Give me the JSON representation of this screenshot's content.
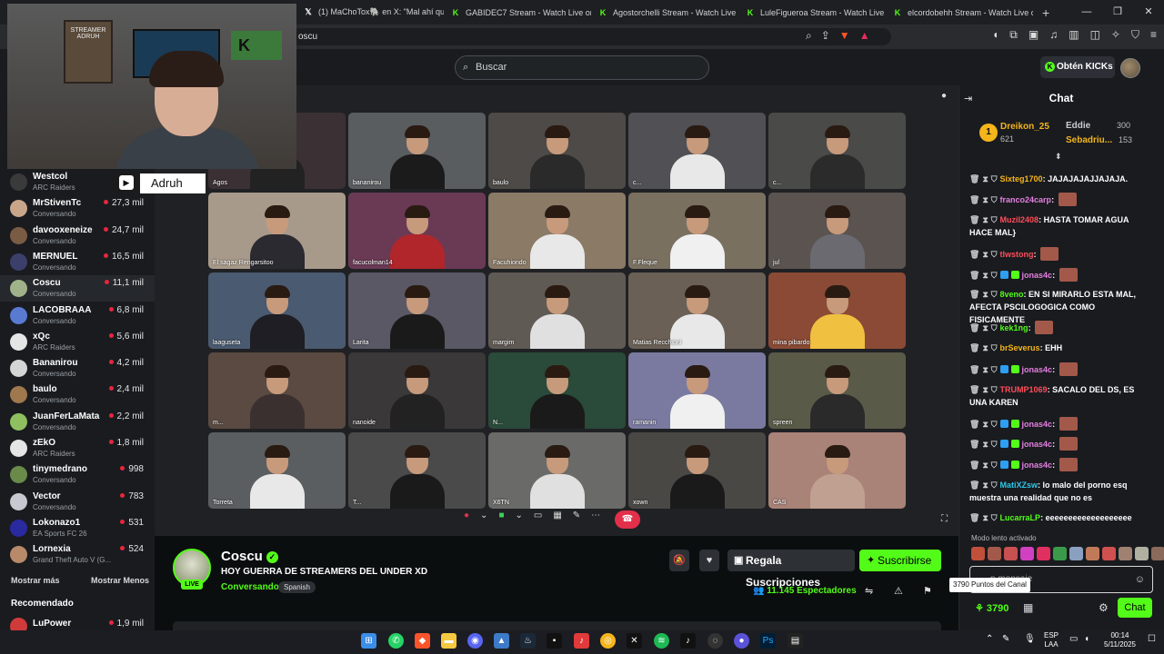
{
  "browser": {
    "tabs": [
      {
        "title": "(1) MaChoTox🐘 en X: \"Mal ahí que",
        "icon": "x"
      },
      {
        "title": "GABIDEC7 Stream - Watch Live on K",
        "icon": "kick"
      },
      {
        "title": "Agostorchelli Stream - Watch Live on",
        "icon": "kick"
      },
      {
        "title": "LuleFigueroa Stream - Watch Live on",
        "icon": "kick"
      },
      {
        "title": "elcordobehh Stream - Watch Live on",
        "icon": "kick"
      }
    ],
    "new_tab": "+",
    "url": "oscu"
  },
  "header": {
    "search_placeholder": "Buscar",
    "kicks_button": "Obtén KICKs"
  },
  "webcam": {
    "poster": "STREAMER ADRUH",
    "sign": "K",
    "name_tag": "Adruh"
  },
  "sidebar": {
    "channels": [
      {
        "name": "Westcol",
        "sub": "ARC Raiders",
        "viewers": "",
        "color": "#3a3a3a"
      },
      {
        "name": "MrStivenTc",
        "sub": "Conversando",
        "viewers": "27,3 mil",
        "color": "#c9a58a"
      },
      {
        "name": "davooxeneize",
        "sub": "Conversando",
        "viewers": "24,7 mil",
        "color": "#7a5b44"
      },
      {
        "name": "MERNUEL",
        "sub": "Conversando",
        "viewers": "16,5 mil",
        "color": "#3b3f6a"
      },
      {
        "name": "Coscu",
        "sub": "Conversando",
        "viewers": "11,1 mil",
        "color": "#9fb28a"
      },
      {
        "name": "LACOBRAAA",
        "sub": "Conversando",
        "viewers": "6,8 mil",
        "color": "#5a7ad2"
      },
      {
        "name": "xQc",
        "sub": "ARC Raiders",
        "viewers": "5,6 mil",
        "color": "#e5e5e5"
      },
      {
        "name": "Bananirou",
        "sub": "Conversando",
        "viewers": "4,2 mil",
        "color": "#d5d5d5"
      },
      {
        "name": "baulo",
        "sub": "Conversando",
        "viewers": "2,4 mil",
        "color": "#a0784e"
      },
      {
        "name": "JuanFerLaMata",
        "sub": "Conversando",
        "viewers": "2,2 mil",
        "color": "#8fc060"
      },
      {
        "name": "zEkO",
        "sub": "ARC Raiders",
        "viewers": "1,8 mil",
        "color": "#e5e5e5"
      },
      {
        "name": "tinymedrano",
        "sub": "Conversando",
        "viewers": "998",
        "color": "#6a8a4a"
      },
      {
        "name": "Vector",
        "sub": "Conversando",
        "viewers": "783",
        "color": "#c8c8d0"
      },
      {
        "name": "Lokonazo1",
        "sub": "EA Sports FC 26",
        "viewers": "531",
        "color": "#2a2aa0"
      },
      {
        "name": "Lornexia",
        "sub": "Grand Theft Auto V (G...",
        "viewers": "524",
        "color": "#b88a6a"
      }
    ],
    "show_more": "Mostrar más",
    "show_less": "Mostrar Menos",
    "recommended_label": "Recomendado",
    "recommended": [
      {
        "name": "LuPower",
        "viewers": "1,9 mil"
      }
    ]
  },
  "call": {
    "tiles": [
      {
        "name": "Agos",
        "bg": "#3b3135",
        "shirt": "#222"
      },
      {
        "name": "bananirou",
        "bg": "#5a5d60",
        "shirt": "#1b1b1b"
      },
      {
        "name": "baulo",
        "bg": "#4d4a47",
        "shirt": "#2a2a2a"
      },
      {
        "name": "c...",
        "bg": "#505055",
        "shirt": "#e8e8e8"
      },
      {
        "name": "c...",
        "bg": "#4a4a48",
        "shirt": "#2b2b2b"
      },
      {
        "name": "El sagaz Rengarsitoo",
        "bg": "#a89a8a",
        "shirt": "#2a2a30"
      },
      {
        "name": "facucolman14",
        "bg": "#6a3a55",
        "shirt": "#b0262b"
      },
      {
        "name": "Facuhiondo",
        "bg": "#8a7a66",
        "shirt": "#e8e8e8"
      },
      {
        "name": "F.Fleque",
        "bg": "#7a7060",
        "shirt": "#f0f0f0"
      },
      {
        "name": "jul",
        "bg": "#5a5350",
        "shirt": "#6a6a70"
      },
      {
        "name": "laaguseta",
        "bg": "#4a5a70",
        "shirt": "#1e1e24"
      },
      {
        "name": "Larita",
        "bg": "#5a5865",
        "shirt": "#1a1a1a"
      },
      {
        "name": "margim",
        "bg": "#605a55",
        "shirt": "#e0e0e0"
      },
      {
        "name": "Matias Recchioni",
        "bg": "#6a6055",
        "shirt": "#e8e8e8"
      },
      {
        "name": "mina pibardo",
        "bg": "#8a4a35",
        "shirt": "#f0c040"
      },
      {
        "name": "m...",
        "bg": "#5a4a42",
        "shirt": "#3a3030"
      },
      {
        "name": "nanoide",
        "bg": "#3a3838",
        "shirt": "#222"
      },
      {
        "name": "N...",
        "bg": "#2a4a3a",
        "shirt": "#1a1a1a"
      },
      {
        "name": "ramanin",
        "bg": "#7a7aa0",
        "shirt": "#f0f0f0"
      },
      {
        "name": "spreen",
        "bg": "#5a5a48",
        "shirt": "#2a2a2a"
      },
      {
        "name": "Torreta",
        "bg": "#5a5e60",
        "shirt": "#e8e8e8"
      },
      {
        "name": "T...",
        "bg": "#4a4a4a",
        "shirt": "#1a1a1a"
      },
      {
        "name": "X6TN",
        "bg": "#6a6a68",
        "shirt": "#e0e0e0"
      },
      {
        "name": "xown",
        "bg": "#4a4845",
        "shirt": "#1a1a1a"
      },
      {
        "name": "CAS",
        "bg": "#a98278",
        "shirt": "#c0a090"
      }
    ]
  },
  "stream": {
    "channel": "Coscu",
    "live_badge": "LIVE",
    "title": "HOY GUERRA DE STREAMERS DEL UNDER XD",
    "category": "Conversando",
    "tag": "Spanish",
    "gift_button": "Regala Suscripciones",
    "subscribe_button": "Suscribirse",
    "viewers_count": "11.145",
    "viewers_label": "Espectadores"
  },
  "chat": {
    "title": "Chat",
    "leaderboard": [
      {
        "name": "Dreikon_25",
        "value": "621",
        "color": "#f5b51b"
      },
      {
        "name": "Eddie",
        "value": "300",
        "color": "#c8cbd0"
      },
      {
        "name": "Sebadriu...",
        "value": "153",
        "color": "#f5b51b"
      }
    ],
    "messages": [
      {
        "user": "Sixteg1700",
        "color": "#f5b51b",
        "text": "JAJAJAJAJJAJAJA.",
        "emote": false,
        "badges": 0
      },
      {
        "user": "franco24carp",
        "color": "#e57fe0",
        "text": "",
        "emote": true,
        "badges": 0
      },
      {
        "user": "Muzil2408",
        "color": "#ff4d5a",
        "text": "HASTA TOMAR AGUA HACE MAL}",
        "emote": false,
        "badges": 0
      },
      {
        "user": "tlwstong",
        "color": "#ff4d5a",
        "text": "",
        "emote": true,
        "badges": 0
      },
      {
        "user": "jonas4c",
        "color": "#e57fe0",
        "text": "",
        "emote": true,
        "badges": 2
      },
      {
        "user": "8veno",
        "color": "#53fc18",
        "text": "EN SI MIRARLO ESTA MAL, AFECTA PSCILOGOGICA COMO FISICAMENTE",
        "emote": false,
        "badges": 0
      },
      {
        "user": "kek1ng",
        "color": "#53fc18",
        "text": "",
        "emote": true,
        "badges": 0
      },
      {
        "user": "brSeverus",
        "color": "#f5b51b",
        "text": "EHH",
        "emote": false,
        "badges": 0
      },
      {
        "user": "jonas4c",
        "color": "#e57fe0",
        "text": "",
        "emote": true,
        "badges": 2
      },
      {
        "user": "TRUMP1069",
        "color": "#ff4d5a",
        "text": "SACALO DEL DS, ES UNA KAREN",
        "emote": false,
        "badges": 0
      },
      {
        "user": "jonas4c",
        "color": "#e57fe0",
        "text": "",
        "emote": true,
        "badges": 2
      },
      {
        "user": "jonas4c",
        "color": "#e57fe0",
        "text": "",
        "emote": true,
        "badges": 2
      },
      {
        "user": "jonas4c",
        "color": "#e57fe0",
        "text": "",
        "emote": true,
        "badges": 2
      },
      {
        "user": "MatiXZsw",
        "color": "#2dc6e8",
        "text": "lo malo del porno esq muestra una realidad que no es",
        "emote": false,
        "badges": 0
      },
      {
        "user": "LucarraLP",
        "color": "#53fc18",
        "text": "eeeeeeeeeeeeeeeeeee",
        "emote": false,
        "badges": 0
      }
    ],
    "slow_mode": "Modo lento activado",
    "input_placeholder": "n mensaje",
    "tooltip": "3790 Puntos del Canal",
    "points": "3790",
    "send_button": "Chat"
  },
  "taskbar": {
    "lang_top": "ESP",
    "lang_bottom": "LAA",
    "time": "00:14",
    "date": "5/11/2025"
  }
}
